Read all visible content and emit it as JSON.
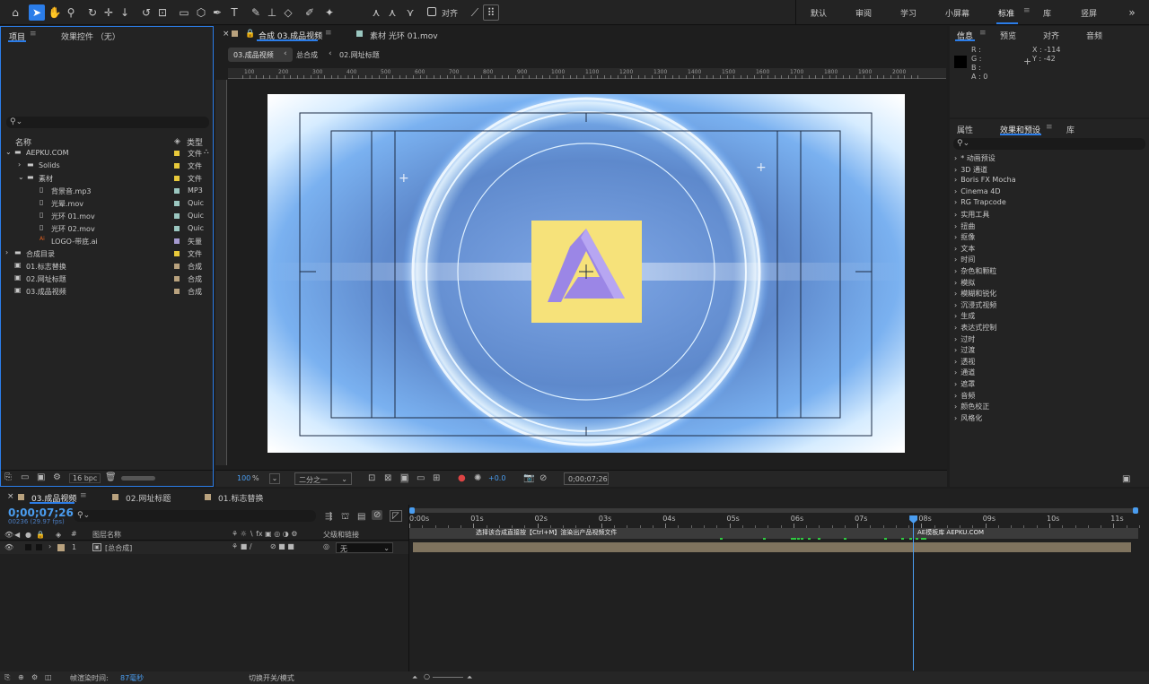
{
  "toolbar": {
    "workspaces": [
      "默认",
      "审阅",
      "学习",
      "小屏幕",
      "标准",
      "库",
      "竖屏"
    ],
    "align_label": "对齐"
  },
  "project": {
    "tab": "项目",
    "effects_tab": "效果控件 （无）",
    "search_placeholder": "",
    "col_name": "名称",
    "col_type": "类型",
    "items": [
      {
        "name": "AEPKU.COM",
        "type": "文件",
        "color": "#e8c93a",
        "indent": 0,
        "kind": "folder",
        "open": true
      },
      {
        "name": "Solids",
        "type": "文件",
        "color": "#e8c93a",
        "indent": 1,
        "kind": "folder",
        "open": false
      },
      {
        "name": "素材",
        "type": "文件",
        "color": "#e8c93a",
        "indent": 1,
        "kind": "folder",
        "open": true
      },
      {
        "name": "背景音.mp3",
        "type": "MP3",
        "color": "#9bc7c0",
        "indent": 2,
        "kind": "file"
      },
      {
        "name": "光晕.mov",
        "type": "Quic",
        "color": "#9bc7c0",
        "indent": 2,
        "kind": "file"
      },
      {
        "name": "光环 01.mov",
        "type": "Quic",
        "color": "#9bc7c0",
        "indent": 2,
        "kind": "file"
      },
      {
        "name": "光环 02.mov",
        "type": "Quic",
        "color": "#9bc7c0",
        "indent": 2,
        "kind": "file"
      },
      {
        "name": "LOGO-带底.ai",
        "type": "矢量",
        "color": "#a59ad0",
        "indent": 2,
        "kind": "ai"
      },
      {
        "name": "合成目录",
        "type": "文件",
        "color": "#e8c93a",
        "indent": 0,
        "kind": "folder",
        "open": false
      },
      {
        "name": "01.标志替换",
        "type": "合成",
        "color": "#b9a27e",
        "indent": 0,
        "kind": "comp"
      },
      {
        "name": "02.网址标题",
        "type": "合成",
        "color": "#b9a27e",
        "indent": 0,
        "kind": "comp"
      },
      {
        "name": "03.成品视频",
        "type": "合成",
        "color": "#b9a27e",
        "indent": 0,
        "kind": "comp"
      }
    ],
    "bpc": "16 bpc"
  },
  "viewer": {
    "tab_comp": "合成 03.成品视频",
    "tab_footage": "素材 光环 01.mov",
    "breadcrumbs": [
      "03.成品视频",
      "总合成",
      "02.网址标题"
    ],
    "ruler_labels": [
      "100",
      "200",
      "300",
      "400",
      "500",
      "600",
      "700",
      "800",
      "900",
      "1000",
      "1100",
      "1200",
      "1300",
      "1400",
      "1500",
      "1600",
      "1700",
      "1800",
      "1900",
      "2000"
    ],
    "zoom": "100",
    "zoom_unit": "%",
    "resolution": "二分之一",
    "exposure": "+0.0",
    "timecode": "0;00;07;26"
  },
  "info": {
    "tabs": [
      "信息",
      "预览",
      "对齐",
      "音频"
    ],
    "r": "R :",
    "g": "G :",
    "b": "B :",
    "a": "A : 0",
    "x": "X : -114",
    "y": "Y : -42"
  },
  "effects": {
    "tabs": [
      "属性",
      "效果和预设",
      "库"
    ],
    "search_placeholder": "",
    "items": [
      "* 动画预设",
      "3D 通道",
      "Boris FX Mocha",
      "Cinema 4D",
      "RG Trapcode",
      "实用工具",
      "扭曲",
      "抠像",
      "文本",
      "时间",
      "杂色和颗粒",
      "模拟",
      "模糊和锐化",
      "沉浸式视频",
      "生成",
      "表达式控制",
      "过时",
      "过渡",
      "透视",
      "通道",
      "遮罩",
      "音频",
      "颜色校正",
      "风格化"
    ]
  },
  "timeline": {
    "tabs": [
      "03.成品视频",
      "02.网址标题",
      "01.标志替换"
    ],
    "timecode": "0;00;07;26",
    "frame_info": "00236 (29.97 fps)",
    "col_num": "#",
    "col_layer": "图层名称",
    "col_parent": "父级和链接",
    "layer": {
      "num": "1",
      "name": "[总合成]",
      "parent": "无"
    },
    "ruler": [
      "0:00s",
      "01s",
      "02s",
      "03s",
      "04s",
      "05s",
      "06s",
      "07s",
      "08s",
      "09s",
      "10s",
      "11s"
    ],
    "marker1": "选择该合成直接按【Ctrl+M】渲染出产品视频文件",
    "marker2": "AE模板库 AEPKU.COM",
    "playhead_seconds": 7.87,
    "render_label": "帧渲染时间:",
    "render_value": "87毫秒",
    "switch_label": "切换开关/模式"
  },
  "colors": {
    "accent": "#2b7de9",
    "folder": "#e8c93a",
    "comp": "#b9a27e",
    "marker": "#2ecc40"
  }
}
